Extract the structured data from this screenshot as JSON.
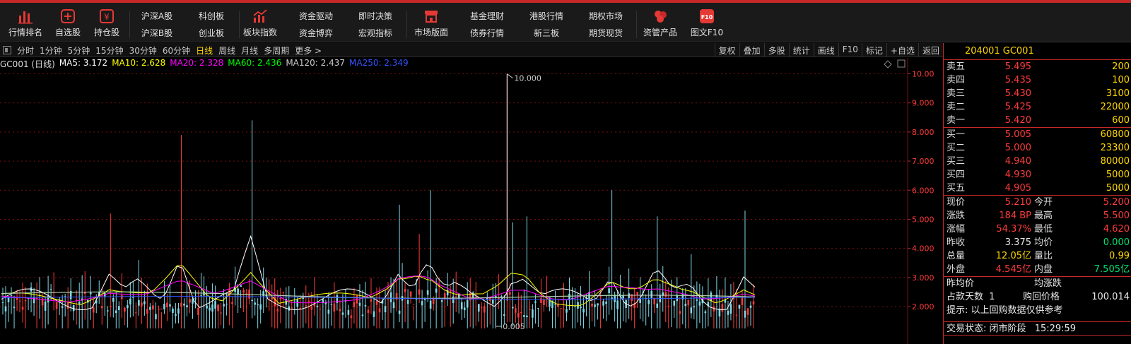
{
  "toolbar": {
    "buttons": [
      {
        "label": "行情排名",
        "icon": "bar-chart-icon"
      },
      {
        "label": "自选股",
        "icon": "plus-box-icon"
      },
      {
        "label": "持仓股",
        "icon": "yen-box-icon"
      }
    ],
    "pairs": [
      {
        "top": "沪深A股",
        "bottom": "沪深B股"
      },
      {
        "top": "科创板",
        "bottom": "创业板"
      }
    ],
    "sector_button": {
      "label": "板块指数",
      "icon": "sector-chart-icon"
    },
    "pairs2": [
      {
        "top": "资金驱动",
        "bottom": "资金博弈"
      },
      {
        "top": "即时决策",
        "bottom": "宏观指标"
      }
    ],
    "market_button": {
      "label": "市场版面",
      "icon": "store-icon"
    },
    "pairs3": [
      {
        "top": "基金理财",
        "bottom": "债券行情"
      },
      {
        "top": "港股行情",
        "bottom": "新三板"
      },
      {
        "top": "期权市场",
        "bottom": "期货现货"
      }
    ],
    "asset_button": {
      "label": "资管产品",
      "icon": "coins-icon"
    },
    "f10_button": {
      "label": "图文F10",
      "icon": "f10-icon",
      "icon_text": "F10"
    }
  },
  "period_bar": {
    "periods": [
      "分时",
      "1分钟",
      "5分钟",
      "15分钟",
      "30分钟",
      "60分钟",
      "日线",
      "周线",
      "月线",
      "多周期",
      "更多 >"
    ],
    "active": "日线",
    "tools": [
      "复权",
      "叠加",
      "多股",
      "统计",
      "画线",
      "F10",
      "标记",
      "+自选",
      "返回"
    ]
  },
  "ma_legend": {
    "symbol": "GC001 (日线)",
    "items": [
      {
        "text": "MA5: 3.172",
        "color": "#ffffff"
      },
      {
        "text": "MA10: 2.628",
        "color": "#ffff00"
      },
      {
        "text": "MA20: 2.328",
        "color": "#ff00ff"
      },
      {
        "text": "MA60: 2.436",
        "color": "#00ff00"
      },
      {
        "text": "MA120: 2.437",
        "color": "#cccccc"
      },
      {
        "text": "MA250: 2.349",
        "color": "#3355ff"
      }
    ]
  },
  "chart_data": {
    "type": "candlestick",
    "y_ticks": [
      "10.00",
      "9.000",
      "8.000",
      "7.000",
      "6.000",
      "5.000",
      "4.000",
      "3.000",
      "2.000"
    ],
    "ylim": [
      1.2,
      10.4
    ],
    "max_label": "10.000",
    "min_label": "0.005",
    "max_value": 10.0,
    "min_value": 0.005,
    "colors": {
      "up": "#ff3b3b",
      "down": "#7fd9e8",
      "grid": "#7a1010"
    }
  },
  "right_panel": {
    "title": "204001 GC001",
    "asks": [
      {
        "name": "卖五",
        "price": "5.495",
        "vol": "200"
      },
      {
        "name": "卖四",
        "price": "5.435",
        "vol": "100"
      },
      {
        "name": "卖三",
        "price": "5.430",
        "vol": "3100"
      },
      {
        "name": "卖二",
        "price": "5.425",
        "vol": "22000"
      },
      {
        "name": "卖一",
        "price": "5.420",
        "vol": "600"
      }
    ],
    "bids": [
      {
        "name": "买一",
        "price": "5.005",
        "vol": "60800"
      },
      {
        "name": "买二",
        "price": "5.000",
        "vol": "23300"
      },
      {
        "name": "买三",
        "price": "4.940",
        "vol": "80000"
      },
      {
        "name": "买四",
        "price": "4.930",
        "vol": "5000"
      },
      {
        "name": "买五",
        "price": "4.905",
        "vol": "5000"
      }
    ],
    "quote": [
      {
        "k1": "现价",
        "v1": "5.210",
        "c1": "red",
        "k2": "今开",
        "v2": "5.200",
        "c2": "red"
      },
      {
        "k1": "涨跌",
        "v1": "184 BP",
        "c1": "red",
        "k2": "最高",
        "v2": "5.500",
        "c2": "red"
      },
      {
        "k1": "涨幅",
        "v1": "54.37%",
        "c1": "red",
        "k2": "最低",
        "v2": "4.620",
        "c2": "red"
      },
      {
        "k1": "昨收",
        "v1": "3.375",
        "c1": "wht",
        "k2": "均价",
        "v2": "0.000",
        "c2": "grn"
      },
      {
        "k1": "总量",
        "v1": "12.05亿",
        "c1": "yel",
        "k2": "量比",
        "v2": "0.99",
        "c2": "yel"
      },
      {
        "k1": "外盘",
        "v1": "4.545亿",
        "c1": "red",
        "k2": "内盘",
        "v2": "7.505亿",
        "c2": "grn"
      }
    ],
    "info": {
      "prev_avg_label": "昨均价",
      "avg_change_label": "均涨跌",
      "days_label": "占款天数",
      "days_value": "1",
      "buyback_label": "购回价格",
      "buyback_value": "100.014",
      "notice": "提示: 以上回购数据仅供参考"
    },
    "status": {
      "label": "交易状态:",
      "value": "闭市阶段",
      "time": "15:29:59"
    }
  }
}
